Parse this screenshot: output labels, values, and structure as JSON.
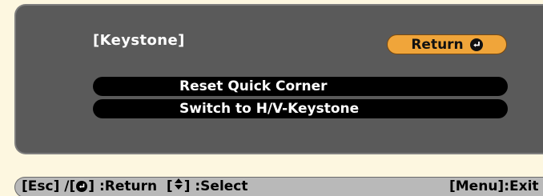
{
  "menu": {
    "title": "[Keystone]",
    "return_label": "Return",
    "items": [
      {
        "label": "Reset Quick Corner"
      },
      {
        "label": "Switch to H/V-Keystone"
      }
    ]
  },
  "status_bar": {
    "esc_text": "[Esc] /[",
    "return_text": "] :Return  [",
    "select_text": "] :Select",
    "exit_text": "[Menu]:Exit"
  },
  "icons": {
    "enter": "enter-icon",
    "up_down": "up-down-arrow-icon"
  },
  "colors": {
    "panel": "#5a5a5a",
    "return_button": "#f0a53a",
    "status_bar": "#b9b9b9",
    "page_background": "#fdf7e0"
  }
}
